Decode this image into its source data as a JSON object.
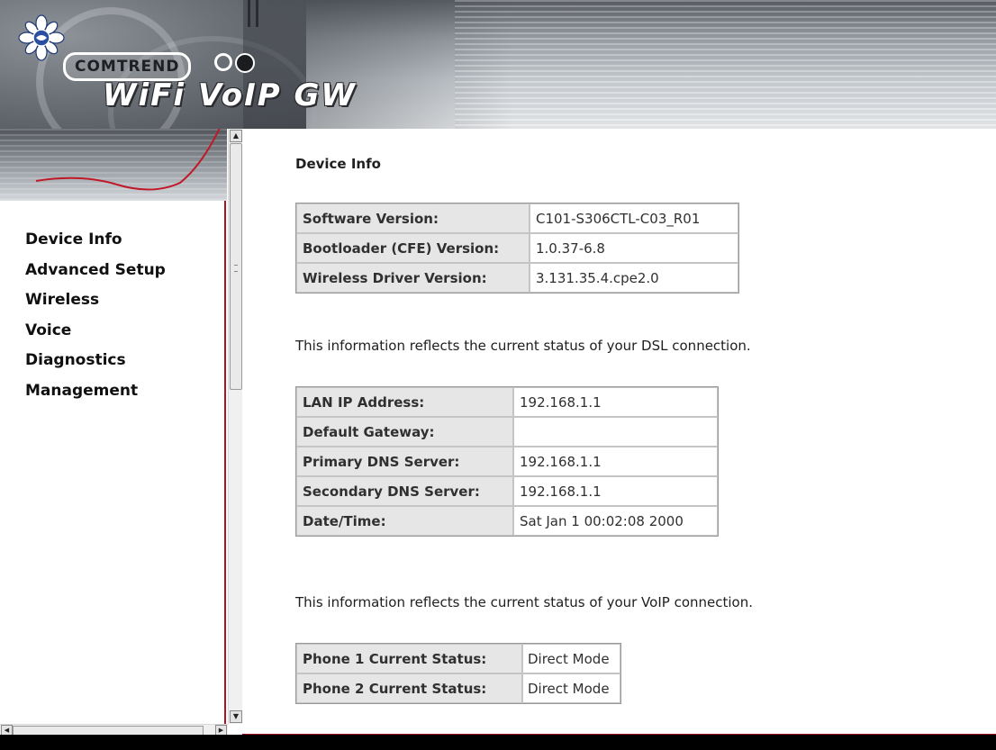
{
  "banner": {
    "brand": "COMTREND",
    "product": "WiFi VoIP GW"
  },
  "nav": {
    "items": [
      {
        "label": "Device Info"
      },
      {
        "label": "Advanced Setup"
      },
      {
        "label": "Wireless"
      },
      {
        "label": "Voice"
      },
      {
        "label": "Diagnostics"
      },
      {
        "label": "Management"
      }
    ]
  },
  "main": {
    "title": "Device Info",
    "software_table": [
      {
        "label": "Software Version:",
        "value": "C101-S306CTL-C03_R01"
      },
      {
        "label": "Bootloader (CFE) Version:",
        "value": "1.0.37-6.8"
      },
      {
        "label": "Wireless Driver Version:",
        "value": "3.131.35.4.cpe2.0"
      }
    ],
    "dsl_note": "This information reflects the current status of your DSL connection.",
    "lan_table": [
      {
        "label": "LAN IP Address:",
        "value": "192.168.1.1"
      },
      {
        "label": "Default Gateway:",
        "value": ""
      },
      {
        "label": "Primary DNS Server:",
        "value": "192.168.1.1"
      },
      {
        "label": "Secondary DNS Server:",
        "value": "192.168.1.1"
      },
      {
        "label": "Date/Time:",
        "value": "Sat Jan 1 00:02:08 2000"
      }
    ],
    "voip_note": "This information reflects the current status of your VoIP connection.",
    "voip_table": [
      {
        "label": "Phone 1 Current Status:",
        "value": "Direct Mode"
      },
      {
        "label": "Phone 2 Current Status:",
        "value": "Direct Mode"
      }
    ]
  },
  "colors": {
    "frame_divider": "#b01020",
    "label_cell_bg": "#e6e6e6"
  }
}
